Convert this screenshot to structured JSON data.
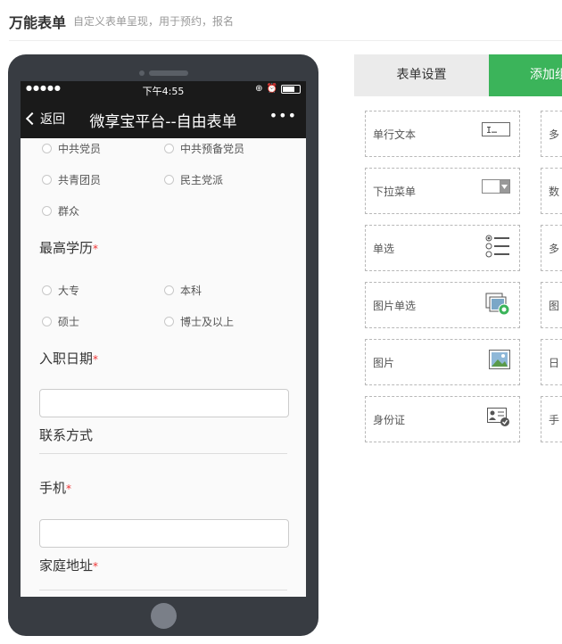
{
  "header": {
    "title": "万能表单",
    "subtitle": "自定义表单呈现，用于预约，报名"
  },
  "phone": {
    "status": {
      "signal": "●●●●●",
      "time": "下午4:55",
      "battery_level": 0.7
    },
    "nav": {
      "back_label": "返回",
      "title": "微享宝平台--自由表单",
      "more": "•••"
    },
    "form": {
      "political_options": [
        "中共党员",
        "中共预备党员",
        "共青团员",
        "民主党派",
        "群众"
      ],
      "education": {
        "label": "最高学历",
        "required_mark": "*",
        "options": [
          "大专",
          "本科",
          "硕士",
          "博士及以上"
        ]
      },
      "hire_date": {
        "label": "入职日期",
        "required_mark": "*",
        "value": ""
      },
      "contact_section": {
        "label": "联系方式"
      },
      "mobile": {
        "label": "手机",
        "required_mark": "*",
        "value": ""
      },
      "address": {
        "label": "家庭地址",
        "required_mark": "*"
      }
    }
  },
  "tabs": {
    "settings": "表单设置",
    "add": "添加组件"
  },
  "widgets": {
    "text": "单行文本",
    "dropdown": "下拉菜单",
    "radio": "单选",
    "image_radio": "图片单选",
    "image": "图片",
    "id_card": "身份证"
  },
  "widgets_right": [
    "多",
    "数",
    "多",
    "图",
    "日",
    "手"
  ],
  "colors": {
    "accent": "#3bb45a",
    "phone_body": "#383c42",
    "nav_bar": "#1a1a1a",
    "required": "#e33333"
  }
}
